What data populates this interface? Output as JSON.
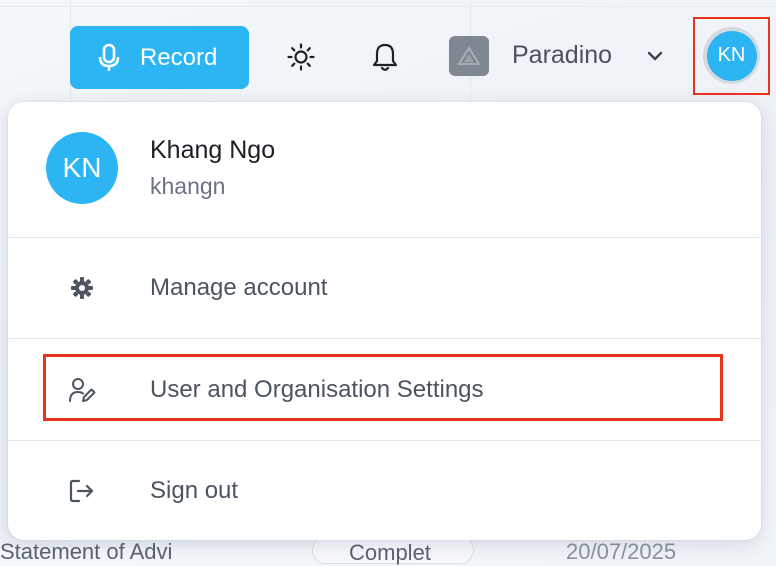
{
  "topbar": {
    "record_label": "Record",
    "org_name": "Paradino",
    "avatar_initials": "KN"
  },
  "menu": {
    "user_initials": "KN",
    "user_name": "Khang Ngo",
    "user_handle": "khangn",
    "items": [
      {
        "label": "Manage account",
        "icon": "gear-icon"
      },
      {
        "label": "User and Organisation Settings",
        "icon": "user-edit-icon"
      },
      {
        "label": "Sign out",
        "icon": "sign-out-icon"
      }
    ]
  },
  "background": {
    "fragment_left": "Statement of Advi",
    "fragment_chip": "Complet",
    "fragment_date": "20/07/2025"
  },
  "colors": {
    "accent": "#2cb4f3",
    "highlight": "#e8331f"
  }
}
